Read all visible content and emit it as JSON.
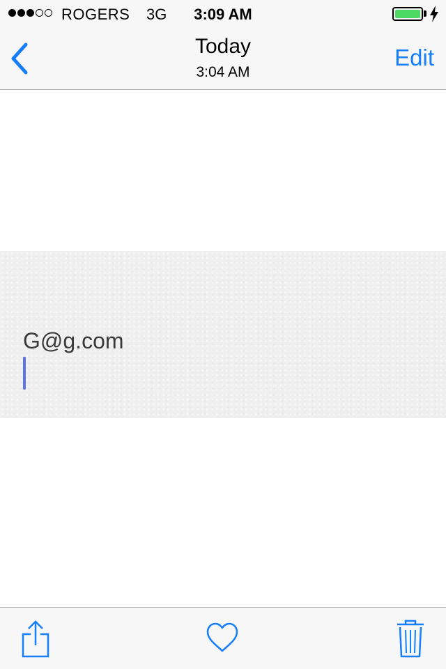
{
  "status_bar": {
    "signal_bars_filled": 3,
    "signal_bars_total": 5,
    "carrier": "ROGERS",
    "network": "3G",
    "time": "3:09 AM",
    "battery_level": 1.0,
    "battery_color": "#4cd964",
    "charging_icon": "lightning-bolt-icon"
  },
  "nav_bar": {
    "back_icon": "chevron-left-icon",
    "title": "Today",
    "subtitle": "3:04 AM",
    "edit_label": "Edit",
    "accent_color": "#157efb"
  },
  "note": {
    "text": "G@g.com"
  },
  "toolbar": {
    "share_icon": "share-icon",
    "favorite_icon": "heart-icon",
    "delete_icon": "trash-icon"
  }
}
